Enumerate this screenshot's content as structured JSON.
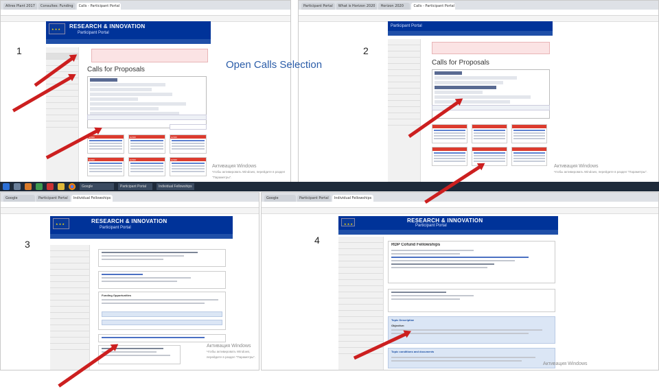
{
  "title": "Open Calls Selection",
  "step_numbers": [
    "1",
    "2",
    "3",
    "4"
  ],
  "banner": {
    "title": "RESEARCH & INNOVATION",
    "subtitle": "Participant Portal"
  },
  "panel1": {
    "tabs": [
      "Altres Plant 2017",
      "Consultes: Funding",
      "Calls - Participant Portal"
    ],
    "heading": "Calls for Proposals",
    "card_labels": [
      "H2020",
      "H2020",
      "H2020",
      "H2020",
      "H2020",
      "H2020",
      "H2020",
      "H2020",
      "H2020"
    ]
  },
  "panel2": {
    "tabs": [
      "Participant Portal",
      "What is Horizon 2020",
      "Horizon 2020",
      "Calls - Participant Portal"
    ],
    "heading": "Calls for Proposals"
  },
  "panel3": {
    "tabs": [
      "Google",
      "Participant Portal",
      "Individual Fellowships"
    ],
    "search_heading": "Funding Opportunities"
  },
  "panel4": {
    "tabs": [
      "Google",
      "Participant Portal",
      "Individual Fellowships"
    ],
    "topic_title": "RDP Cofund Fellowships",
    "section_titles": [
      "Topic Description",
      "Topic conditions and documents"
    ],
    "objective_label": "Objective:"
  },
  "watermark": {
    "main": "Активация Windows",
    "sub": "Чтобы активировать Windows, перейдите в раздел \"Параметры\"."
  },
  "colors": {
    "eu_blue": "#003399",
    "arrow_red": "#cc1f1f",
    "title_blue": "#2a5ca8"
  }
}
